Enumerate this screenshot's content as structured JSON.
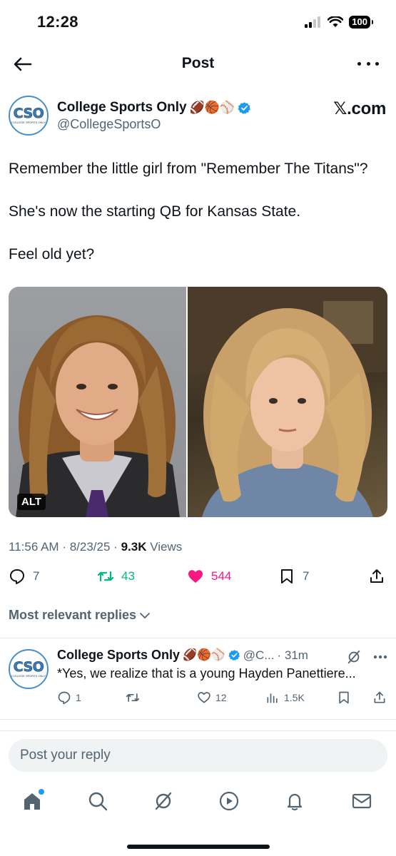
{
  "status": {
    "time": "12:28",
    "battery": "100"
  },
  "topbar": {
    "title": "Post"
  },
  "author": {
    "avatar_text": "CSO",
    "avatar_subtext": "COLLEGE SPORTS ONLY",
    "name": "College Sports Only",
    "emojis": "🏈🏀⚾",
    "handle": "@CollegeSportsO",
    "watermark": "𝕏.com"
  },
  "tweet": {
    "lines": [
      "Remember the little girl from \"Remember The Titans\"?",
      "She's now the starting QB for Kansas State.",
      "Feel old yet?"
    ],
    "alt_badge": "ALT",
    "time": "11:56 AM",
    "date": "8/23/25",
    "views_count": "9.3K",
    "views_label": "Views"
  },
  "actions": {
    "replies": "7",
    "reposts": "43",
    "likes": "544",
    "bookmarks": "7"
  },
  "replies_filter": "Most relevant replies",
  "reply": {
    "name": "College Sports Only",
    "emojis": "🏈🏀⚾",
    "handle": "@C...",
    "time": "· 31m",
    "text": "*Yes, we realize that is a young Hayden Panettiere...",
    "replies": "1",
    "likes": "12",
    "views": "1.5K"
  },
  "composer": {
    "placeholder": "Post your reply"
  },
  "colors": {
    "verified": "#1d9bf0",
    "like": "#f91880",
    "repost": "#00ba7c",
    "accent": "#1d9bf0"
  }
}
